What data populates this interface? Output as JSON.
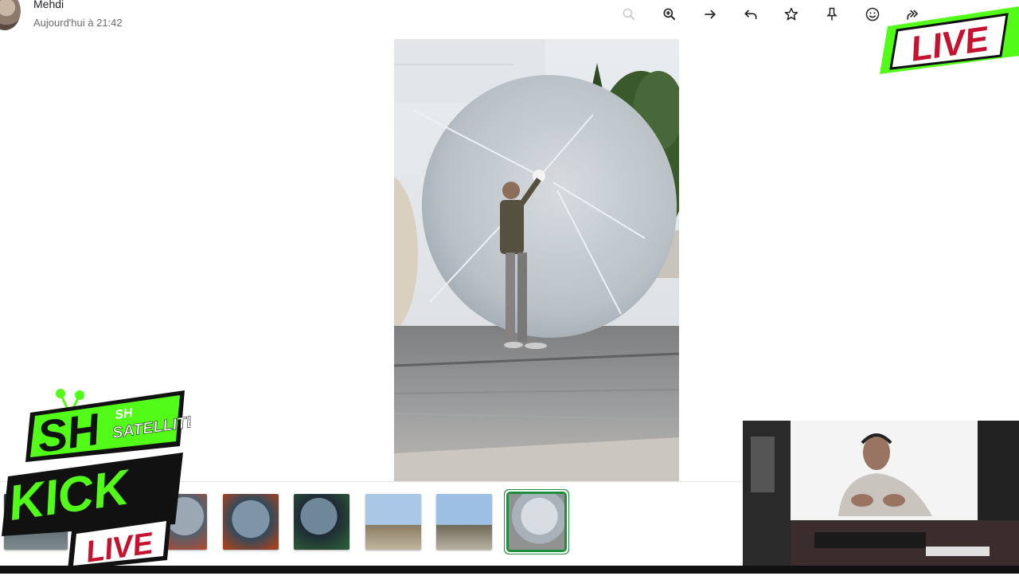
{
  "message": {
    "sender": "Mehdi",
    "timestamp": "Aujourd'hui à 21:42"
  },
  "toolbar": {
    "icons": [
      "search-icon",
      "zoom-in-icon",
      "arrow-right-icon",
      "reply-icon",
      "star-icon",
      "pin-icon",
      "emoji-icon",
      "forward-icon",
      "download-icon",
      "more-icon"
    ]
  },
  "overlays": {
    "live_top": "LIVE",
    "logo_sh": "SH",
    "logo_sh_small": "SH",
    "logo_satellite": "SATELLITE",
    "logo_kick": "KICK",
    "logo_live": "LIVE"
  },
  "thumbnails": {
    "count": 6,
    "active_index": 5
  },
  "colors": {
    "accent_green": "#1e8e3e",
    "kick_green": "#53fc18",
    "live_red": "#c4122f"
  }
}
